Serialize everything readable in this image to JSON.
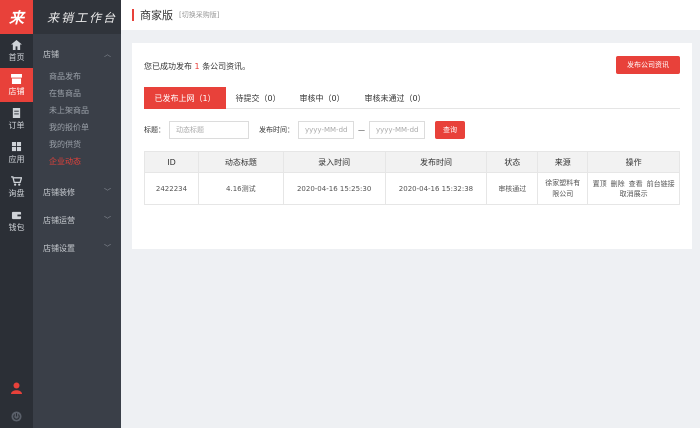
{
  "rail": {
    "logo": "来",
    "items": [
      {
        "label": "首页",
        "icon": "home-icon"
      },
      {
        "label": "店铺",
        "icon": "store-icon",
        "active": true
      },
      {
        "label": "订单",
        "icon": "order-icon"
      },
      {
        "label": "应用",
        "icon": "apps-icon"
      },
      {
        "label": "询盘",
        "icon": "cart-icon"
      },
      {
        "label": "钱包",
        "icon": "wallet-icon"
      }
    ]
  },
  "sidebar": {
    "title": "来销工作台",
    "group_store": "店铺",
    "sub_items": [
      "商品发布",
      "在售商品",
      "未上架商品",
      "我的报价单",
      "我的供货",
      "企业动态"
    ],
    "group_decor": "店铺装修",
    "group_ops": "店铺运营",
    "group_settings": "店铺设置"
  },
  "header": {
    "title": "商家版",
    "switch": "[切换采购版]"
  },
  "notice": {
    "prefix": "您已成功发布",
    "count": "1",
    "suffix": "条公司资讯。"
  },
  "publish_button": "发布公司资讯",
  "tabs": [
    "已发布上网（1）",
    "待提交（0）",
    "审核中（0）",
    "审核未通过（0）"
  ],
  "filter": {
    "title_label": "标题：",
    "title_placeholder": "动态标题",
    "time_label": "发布时间：",
    "date_placeholder": "yyyy-MM-dd",
    "dash": "—",
    "query_button": "查询"
  },
  "table": {
    "headers": [
      "ID",
      "动态标题",
      "录入时间",
      "发布时间",
      "状态",
      "来源",
      "操作"
    ],
    "row": {
      "id": "2422234",
      "title": "4.16测试",
      "entry_time": "2020-04-16 15:25:30",
      "publish_time": "2020-04-16 15:32:38",
      "status": "审核通过",
      "source": "徐家塑料有限公司",
      "ops": [
        "置顶",
        "删除",
        "查看",
        "前台链接",
        "取消展示"
      ]
    }
  },
  "colors": {
    "accent": "#e8413a",
    "rail_bg": "#2b2f36",
    "sidebar_bg": "#3a3f48"
  }
}
